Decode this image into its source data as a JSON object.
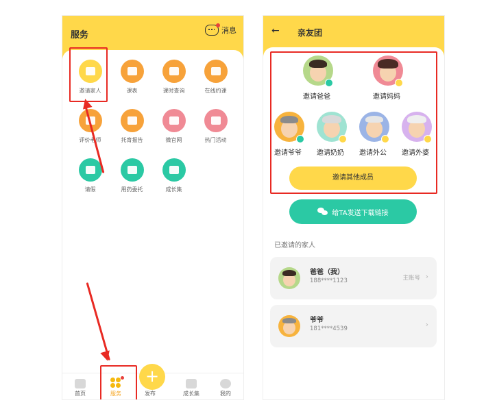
{
  "left": {
    "title": "服务",
    "message_label": "消息",
    "services": [
      {
        "label": "邀请家人",
        "color": "#FFD84A",
        "icon": "invite-family-icon"
      },
      {
        "label": "课表",
        "color": "#F7A23A",
        "icon": "schedule-icon"
      },
      {
        "label": "课时查询",
        "color": "#F7A23A",
        "icon": "class-hours-icon"
      },
      {
        "label": "在线约课",
        "color": "#F7A23A",
        "icon": "book-class-icon"
      },
      {
        "label": "评价老师",
        "color": "#F7A23A",
        "icon": "rate-teacher-icon"
      },
      {
        "label": "托育报告",
        "color": "#F7A23A",
        "icon": "report-icon"
      },
      {
        "label": "微官网",
        "color": "#F08A95",
        "icon": "micro-site-icon"
      },
      {
        "label": "热门活动",
        "color": "#F08A95",
        "icon": "activity-icon"
      },
      {
        "label": "请假",
        "color": "#2BC9A4",
        "icon": "leave-icon"
      },
      {
        "label": "用药委托",
        "color": "#2BC9A4",
        "icon": "medication-icon"
      },
      {
        "label": "成长集",
        "color": "#2BC9A4",
        "icon": "growth-album-icon"
      }
    ],
    "tabs": {
      "home": "首页",
      "service": "服务",
      "publish": "发布",
      "publish_symbol": "+",
      "growth": "成长集",
      "mine": "我的"
    }
  },
  "right": {
    "back_symbol": "←",
    "title": "亲友团",
    "members": [
      {
        "label": "邀请爸爸",
        "check_color": "#2BC9A4"
      },
      {
        "label": "邀请妈妈",
        "check_color": "#FFD84A"
      },
      {
        "label": "邀请爷爷",
        "check_color": "#2BC9A4"
      },
      {
        "label": "邀请奶奶",
        "check_color": "#FFD84A"
      },
      {
        "label": "邀请外公",
        "check_color": "#FFD84A"
      },
      {
        "label": "邀请外婆",
        "check_color": "#FFD84A"
      }
    ],
    "invite_other": "邀请其他成员",
    "send_link": "给TA发送下载链接",
    "invited_title": "已邀请的家人",
    "invited": [
      {
        "name": "爸爸（我）",
        "phone": "188****1123",
        "tag": "主账号",
        "chevron": "›"
      },
      {
        "name": "爷爷",
        "phone": "181****4539",
        "tag": "",
        "chevron": "›"
      }
    ]
  }
}
